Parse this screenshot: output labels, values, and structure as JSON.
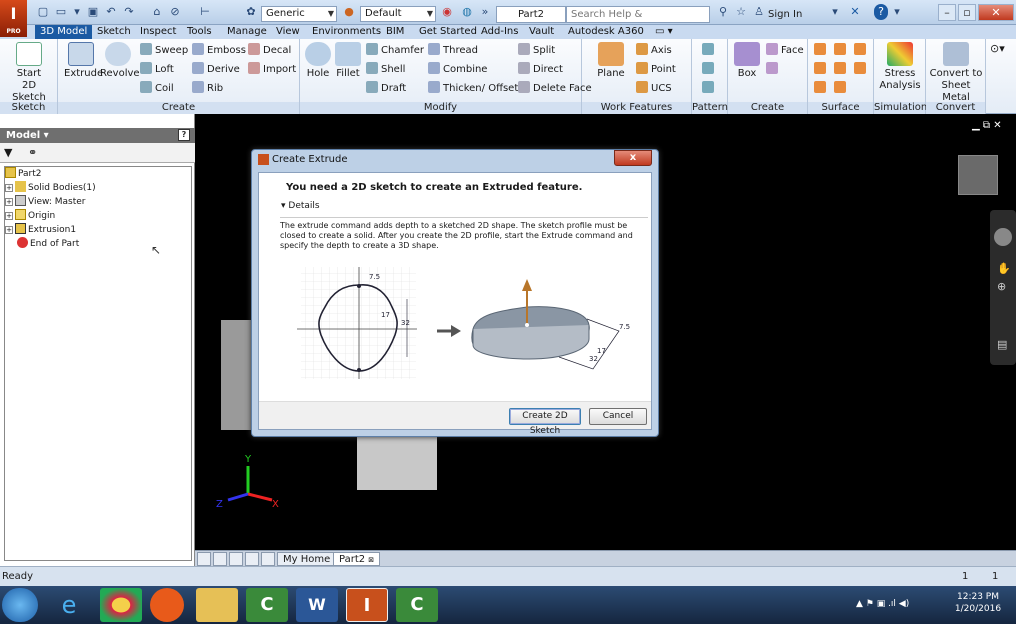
{
  "app": {
    "logo_text": "I",
    "logo_sub": "PRO",
    "document_tab": "Part2",
    "search_placeholder": "Search Help & Commands...",
    "sign_in": "Sign In",
    "material": "Generic",
    "appearance": "Default",
    "help": "?"
  },
  "ribbon_tabs": [
    "3D Model",
    "Sketch",
    "Inspect",
    "Tools",
    "Manage",
    "View",
    "Environments",
    "BIM",
    "Get Started",
    "Add-Ins",
    "Vault",
    "Autodesk A360"
  ],
  "ribbon": {
    "sketch": {
      "label": "Sketch",
      "start_label": "Start",
      "start_label2": "2D Sketch"
    },
    "create": {
      "label": "Create",
      "extrude": "Extrude",
      "revolve": "Revolve",
      "sweep": "Sweep",
      "emboss": "Emboss",
      "decal": "Decal",
      "loft": "Loft",
      "derive": "Derive",
      "import": "Import",
      "coil": "Coil",
      "rib": "Rib"
    },
    "modify": {
      "label": "Modify",
      "hole": "Hole",
      "fillet": "Fillet",
      "chamfer": "Chamfer",
      "thread": "Thread",
      "split": "Split",
      "shell": "Shell",
      "combine": "Combine",
      "direct": "Direct",
      "draft": "Draft",
      "thicken": "Thicken/ Offset",
      "delete_face": "Delete Face"
    },
    "work_features": {
      "label": "Work Features",
      "plane": "Plane",
      "axis": "Axis",
      "point": "Point",
      "ucs": "UCS"
    },
    "pattern": {
      "label": "Pattern"
    },
    "freeform": {
      "label": "Create Freeform",
      "box": "Box",
      "face": "Face"
    },
    "surface": {
      "label": "Surface"
    },
    "simulation": {
      "label": "Simulation",
      "stress": "Stress",
      "stress2": "Analysis"
    },
    "convert": {
      "label": "Convert",
      "sheet": "Convert to",
      "sheet2": "Sheet Metal"
    }
  },
  "browser": {
    "title": "Model",
    "help": "?",
    "tree": [
      {
        "label": "Part2",
        "icon": "part-icon"
      },
      {
        "label": "Solid Bodies(1)",
        "icon": "folder-icon"
      },
      {
        "label": "View: Master",
        "icon": "view-icon"
      },
      {
        "label": "Origin",
        "icon": "folder-icon"
      },
      {
        "label": "Extrusion1",
        "icon": "extrusion-icon"
      },
      {
        "label": "End of Part",
        "icon": "end-icon"
      }
    ]
  },
  "dialog": {
    "title": "Create Extrude",
    "close": "x",
    "message": "You need a 2D sketch to create an Extruded feature.",
    "details": "Details",
    "paragraph": "The extrude command adds depth to a sketched 2D shape. The sketch profile must be closed to create a solid. After you create the 2D profile, start the Extrude command and specify the depth to create a 3D shape.",
    "dim1": "7.5",
    "dim2": "17",
    "dim3": "32",
    "create_button": "Create 2D Sketch",
    "cancel_button": "Cancel"
  },
  "doc_tabs": [
    "My Home",
    "Part2"
  ],
  "status": {
    "text": "Ready",
    "count1": "1",
    "count2": "1"
  },
  "taskbar": {
    "time": "12:23 PM",
    "date": "1/20/2016"
  },
  "axis": {
    "x": "X",
    "y": "Y",
    "z": "Z"
  }
}
